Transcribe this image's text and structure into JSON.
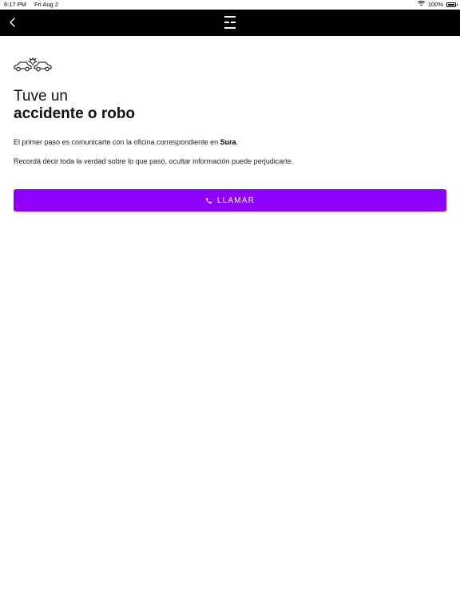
{
  "status_bar": {
    "time": "6:17 PM",
    "date": "Fri Aug 2",
    "battery": "100%",
    "battery_level": 1.0
  },
  "nav": {
    "back_icon": "chevron-left-icon",
    "logo_icon": "brand-logo-icon"
  },
  "page": {
    "icon": "car-crash-icon",
    "title_line1": "Tuve un",
    "title_line2": "accidente o robo",
    "para1_prefix": "El primer paso es comunicarte con la oficina correspondiente en ",
    "para1_insurer": "Sura",
    "para1_suffix": ".",
    "para2": "Recordá decir toda la verdad sobre lo que pasó, ocultar información puede perjudicarte."
  },
  "call_button": {
    "label": "LLAMAR",
    "icon": "phone-icon",
    "color": "#9000ff"
  },
  "colors": {
    "nav_background": "#000000",
    "accent": "#9000ff",
    "background": "#ffffff"
  }
}
